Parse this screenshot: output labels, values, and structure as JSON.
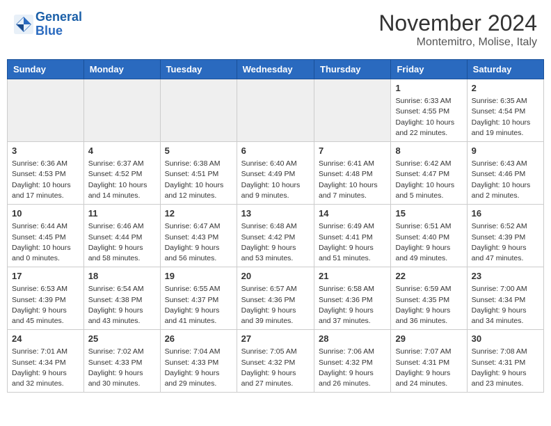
{
  "header": {
    "logo_line1": "General",
    "logo_line2": "Blue",
    "month_title": "November 2024",
    "location": "Montemitro, Molise, Italy"
  },
  "weekdays": [
    "Sunday",
    "Monday",
    "Tuesday",
    "Wednesday",
    "Thursday",
    "Friday",
    "Saturday"
  ],
  "weeks": [
    [
      {
        "day": "",
        "info": ""
      },
      {
        "day": "",
        "info": ""
      },
      {
        "day": "",
        "info": ""
      },
      {
        "day": "",
        "info": ""
      },
      {
        "day": "",
        "info": ""
      },
      {
        "day": "1",
        "info": "Sunrise: 6:33 AM\nSunset: 4:55 PM\nDaylight: 10 hours and 22 minutes."
      },
      {
        "day": "2",
        "info": "Sunrise: 6:35 AM\nSunset: 4:54 PM\nDaylight: 10 hours and 19 minutes."
      }
    ],
    [
      {
        "day": "3",
        "info": "Sunrise: 6:36 AM\nSunset: 4:53 PM\nDaylight: 10 hours and 17 minutes."
      },
      {
        "day": "4",
        "info": "Sunrise: 6:37 AM\nSunset: 4:52 PM\nDaylight: 10 hours and 14 minutes."
      },
      {
        "day": "5",
        "info": "Sunrise: 6:38 AM\nSunset: 4:51 PM\nDaylight: 10 hours and 12 minutes."
      },
      {
        "day": "6",
        "info": "Sunrise: 6:40 AM\nSunset: 4:49 PM\nDaylight: 10 hours and 9 minutes."
      },
      {
        "day": "7",
        "info": "Sunrise: 6:41 AM\nSunset: 4:48 PM\nDaylight: 10 hours and 7 minutes."
      },
      {
        "day": "8",
        "info": "Sunrise: 6:42 AM\nSunset: 4:47 PM\nDaylight: 10 hours and 5 minutes."
      },
      {
        "day": "9",
        "info": "Sunrise: 6:43 AM\nSunset: 4:46 PM\nDaylight: 10 hours and 2 minutes."
      }
    ],
    [
      {
        "day": "10",
        "info": "Sunrise: 6:44 AM\nSunset: 4:45 PM\nDaylight: 10 hours and 0 minutes."
      },
      {
        "day": "11",
        "info": "Sunrise: 6:46 AM\nSunset: 4:44 PM\nDaylight: 9 hours and 58 minutes."
      },
      {
        "day": "12",
        "info": "Sunrise: 6:47 AM\nSunset: 4:43 PM\nDaylight: 9 hours and 56 minutes."
      },
      {
        "day": "13",
        "info": "Sunrise: 6:48 AM\nSunset: 4:42 PM\nDaylight: 9 hours and 53 minutes."
      },
      {
        "day": "14",
        "info": "Sunrise: 6:49 AM\nSunset: 4:41 PM\nDaylight: 9 hours and 51 minutes."
      },
      {
        "day": "15",
        "info": "Sunrise: 6:51 AM\nSunset: 4:40 PM\nDaylight: 9 hours and 49 minutes."
      },
      {
        "day": "16",
        "info": "Sunrise: 6:52 AM\nSunset: 4:39 PM\nDaylight: 9 hours and 47 minutes."
      }
    ],
    [
      {
        "day": "17",
        "info": "Sunrise: 6:53 AM\nSunset: 4:39 PM\nDaylight: 9 hours and 45 minutes."
      },
      {
        "day": "18",
        "info": "Sunrise: 6:54 AM\nSunset: 4:38 PM\nDaylight: 9 hours and 43 minutes."
      },
      {
        "day": "19",
        "info": "Sunrise: 6:55 AM\nSunset: 4:37 PM\nDaylight: 9 hours and 41 minutes."
      },
      {
        "day": "20",
        "info": "Sunrise: 6:57 AM\nSunset: 4:36 PM\nDaylight: 9 hours and 39 minutes."
      },
      {
        "day": "21",
        "info": "Sunrise: 6:58 AM\nSunset: 4:36 PM\nDaylight: 9 hours and 37 minutes."
      },
      {
        "day": "22",
        "info": "Sunrise: 6:59 AM\nSunset: 4:35 PM\nDaylight: 9 hours and 36 minutes."
      },
      {
        "day": "23",
        "info": "Sunrise: 7:00 AM\nSunset: 4:34 PM\nDaylight: 9 hours and 34 minutes."
      }
    ],
    [
      {
        "day": "24",
        "info": "Sunrise: 7:01 AM\nSunset: 4:34 PM\nDaylight: 9 hours and 32 minutes."
      },
      {
        "day": "25",
        "info": "Sunrise: 7:02 AM\nSunset: 4:33 PM\nDaylight: 9 hours and 30 minutes."
      },
      {
        "day": "26",
        "info": "Sunrise: 7:04 AM\nSunset: 4:33 PM\nDaylight: 9 hours and 29 minutes."
      },
      {
        "day": "27",
        "info": "Sunrise: 7:05 AM\nSunset: 4:32 PM\nDaylight: 9 hours and 27 minutes."
      },
      {
        "day": "28",
        "info": "Sunrise: 7:06 AM\nSunset: 4:32 PM\nDaylight: 9 hours and 26 minutes."
      },
      {
        "day": "29",
        "info": "Sunrise: 7:07 AM\nSunset: 4:31 PM\nDaylight: 9 hours and 24 minutes."
      },
      {
        "day": "30",
        "info": "Sunrise: 7:08 AM\nSunset: 4:31 PM\nDaylight: 9 hours and 23 minutes."
      }
    ]
  ]
}
